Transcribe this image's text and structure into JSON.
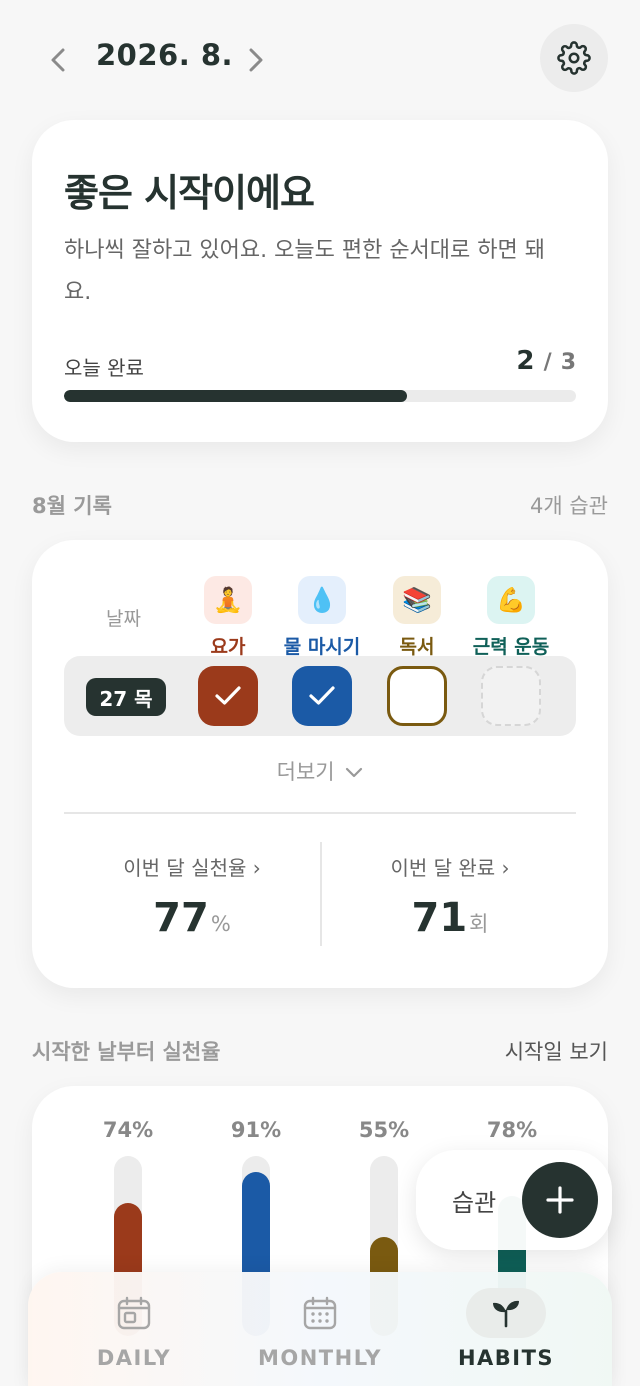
{
  "header": {
    "month": "2026. 8.",
    "prev_icon": "chevron-left-icon",
    "next_icon": "chevron-right-icon",
    "settings_icon": "gear-icon"
  },
  "summary": {
    "title": "좋은 시작이에요",
    "message": "하나씩 잘하고 있어요. 오늘도 편한 순서대로 하면 돼요.",
    "progress_label": "오늘 완료",
    "done": "2",
    "separator": "/",
    "total": "3",
    "progress_fraction": 0.67
  },
  "records_section": {
    "title": "8월 기록",
    "count": "4개 습관"
  },
  "records": {
    "date_header": "날짜",
    "habits": [
      {
        "name": "요가",
        "emoji": "🧘",
        "color": "#9b3a1b",
        "tint": "#fde9e4",
        "checked": true
      },
      {
        "name": "물 마시기",
        "emoji": "💧",
        "color": "#1b5aa6",
        "tint": "#e4effc",
        "checked": true
      },
      {
        "name": "독서",
        "emoji": "📚",
        "color": "#7a5a10",
        "tint": "#f6ecd8",
        "checked": false
      },
      {
        "name": "근력 운동",
        "emoji": "💪",
        "color": "#0f6058",
        "tint": "#dcf4f2",
        "checked": false
      }
    ],
    "today_label": "27 목",
    "more_label": "더보기",
    "stats": [
      {
        "label": "이번 달 실천율",
        "value": "77",
        "unit": "%"
      },
      {
        "label": "이번 달 완료",
        "value": "71",
        "unit": "회"
      }
    ]
  },
  "rates_section": {
    "title": "시작한 날부터 실천율",
    "link": "시작일 보기"
  },
  "rates": [
    {
      "label": "74%",
      "value": 74,
      "color": "#9b3a1b"
    },
    {
      "label": "91%",
      "value": 91,
      "color": "#1b5aa6"
    },
    {
      "label": "55%",
      "value": 55,
      "color": "#7a5a10"
    },
    {
      "label": "78%",
      "value": 78,
      "color": "#0f6058"
    }
  ],
  "fab": {
    "label": "습관",
    "icon": "plus-icon"
  },
  "bottom_nav": [
    {
      "label": "DAILY",
      "icon": "calendar-day-icon",
      "active": false
    },
    {
      "label": "MONTHLY",
      "icon": "calendar-month-icon",
      "active": false
    },
    {
      "label": "HABITS",
      "icon": "sprout-icon",
      "active": true
    }
  ]
}
